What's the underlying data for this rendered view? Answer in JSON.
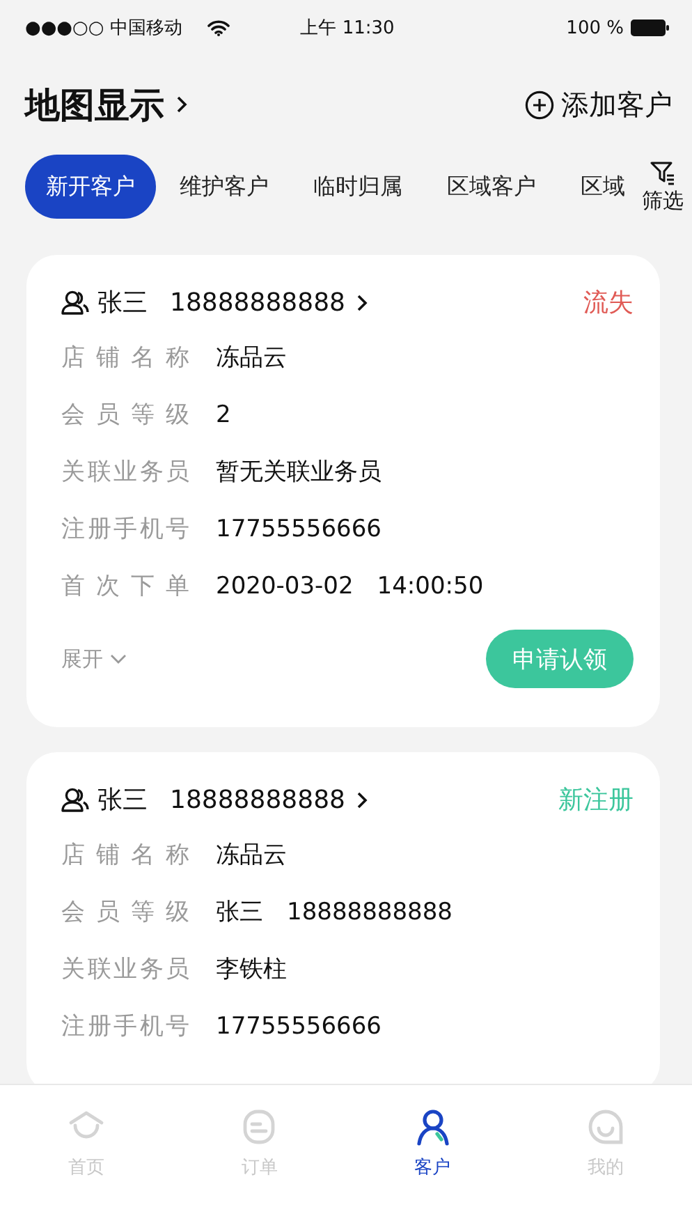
{
  "status_bar": {
    "carrier": "●●●○○ 中国移动",
    "time": "上午 11:30",
    "battery": "100 %"
  },
  "header": {
    "title": "地图显示",
    "action": "添加客户"
  },
  "tabs": [
    {
      "label": "新开客户",
      "selected": true
    },
    {
      "label": "维护客户",
      "selected": false
    },
    {
      "label": "临时归属",
      "selected": false
    },
    {
      "label": "区域客户",
      "selected": false
    },
    {
      "label": "区域",
      "selected": false
    }
  ],
  "filter": {
    "label": "筛选"
  },
  "cards": [
    {
      "name": "张三",
      "phone": "18888888888",
      "status": "流失",
      "color": "#e05a55",
      "fields": [
        {
          "label": "店铺名称",
          "value": "冻品云"
        },
        {
          "label": "会员等级",
          "value": "2"
        },
        {
          "label": "关联业务员",
          "value": "暂无关联业务员"
        },
        {
          "label": "注册手机号",
          "value": "17755556666"
        },
        {
          "label": "首次下单",
          "value": "2020-03-02　14:00:50"
        }
      ],
      "footer": {
        "expand": "展开",
        "button": "申请认领"
      }
    },
    {
      "name": "张三",
      "phone": "18888888888",
      "status": "新注册",
      "color": "#3cc69c",
      "fields": [
        {
          "label": "店铺名称",
          "value": "冻品云"
        },
        {
          "label": "会员等级",
          "value": "张三　18888888888"
        },
        {
          "label": "关联业务员",
          "value": "李铁柱"
        },
        {
          "label": "注册手机号",
          "value": "17755556666"
        }
      ]
    }
  ],
  "tab_bar": [
    {
      "label": "首页",
      "kind": "home",
      "selected": false
    },
    {
      "label": "订单",
      "kind": "order",
      "selected": false
    },
    {
      "label": "客户",
      "kind": "customer",
      "selected": true
    },
    {
      "label": "我的",
      "kind": "me",
      "selected": false
    }
  ]
}
